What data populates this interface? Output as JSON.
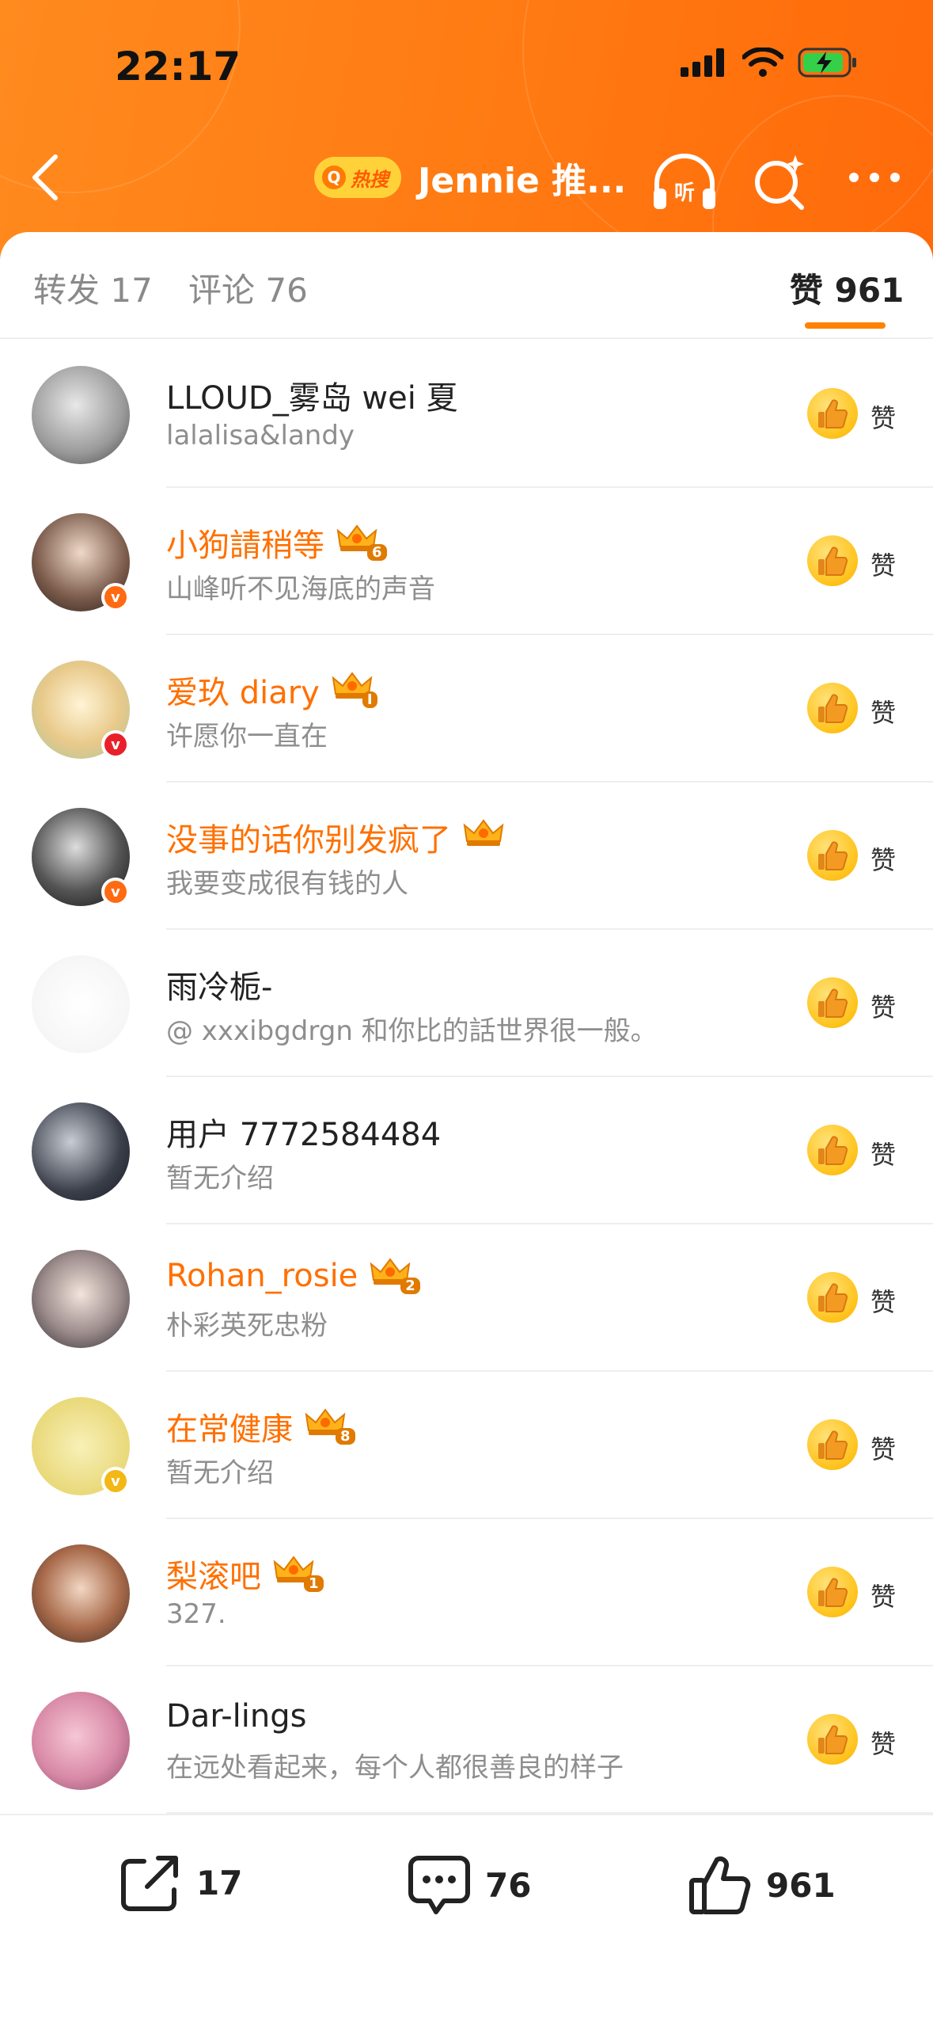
{
  "status_bar": {
    "time": "22:17"
  },
  "nav": {
    "hot_badge": "热搜",
    "title": "Jennie 推..."
  },
  "tabs": [
    {
      "label": "转发 17"
    },
    {
      "label": "评论 76"
    },
    {
      "label": "赞 961"
    }
  ],
  "like_label": "赞",
  "users": [
    {
      "name": "LLOUD_雾岛 wei 夏",
      "bio": "lalalisa&landy",
      "vip": false,
      "verified": "",
      "crown": ""
    },
    {
      "name": "小狗請稍等",
      "bio": "山峰听不见海底的声音",
      "vip": true,
      "verified": "orange",
      "crown": "6"
    },
    {
      "name": "爱玖 diary",
      "bio": "许愿你一直在",
      "vip": true,
      "verified": "red",
      "crown": "I"
    },
    {
      "name": "没事的话你别发疯了",
      "bio": "我要变成很有钱的人",
      "vip": true,
      "verified": "orange",
      "crown": ""
    },
    {
      "name": "雨冷栀-",
      "bio": "@ xxxibgdrgn 和你比的話世界很一般。",
      "vip": false,
      "verified": "",
      "crown": ""
    },
    {
      "name": "用户 7772584484",
      "bio": "暂无介绍",
      "vip": false,
      "verified": "",
      "crown": ""
    },
    {
      "name": "Rohan_rosie",
      "bio": "朴彩英死忠粉",
      "vip": true,
      "verified": "",
      "crown": "2"
    },
    {
      "name": "在常健康",
      "bio": "暂无介绍",
      "vip": true,
      "verified": "yellow",
      "crown": "8"
    },
    {
      "name": "梨滚吧",
      "bio": "327.",
      "vip": true,
      "verified": "",
      "crown": "1"
    },
    {
      "name": "Dar-lings",
      "bio": "在远处看起来，每个人都很善良的样子",
      "vip": false,
      "verified": "",
      "crown": ""
    }
  ],
  "bottom_bar": {
    "repost_count": "17",
    "comment_count": "76",
    "like_count": "961"
  },
  "colors": {
    "accent": "#ff8200",
    "vip_name": "#ff7000",
    "header": "#ff7a12"
  }
}
